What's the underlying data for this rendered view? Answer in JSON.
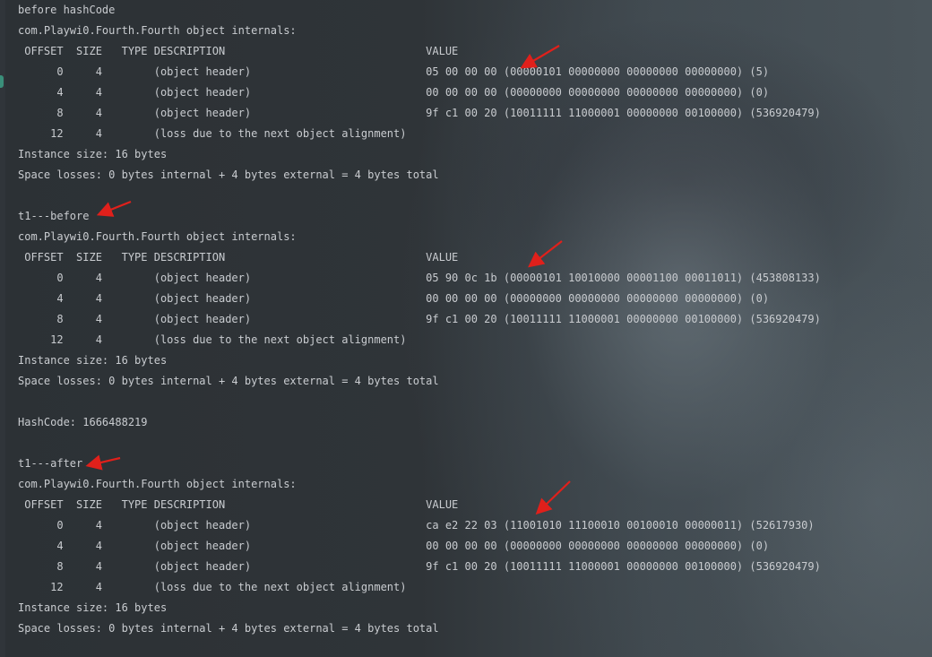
{
  "lines": [
    "before hashCode",
    "com.Playwi0.Fourth.Fourth object internals:",
    " OFFSET  SIZE   TYPE DESCRIPTION                               VALUE",
    "      0     4        (object header)                           05 00 00 00 (00000101 00000000 00000000 00000000) (5)",
    "      4     4        (object header)                           00 00 00 00 (00000000 00000000 00000000 00000000) (0)",
    "      8     4        (object header)                           9f c1 00 20 (10011111 11000001 00000000 00100000) (536920479)",
    "     12     4        (loss due to the next object alignment)",
    "Instance size: 16 bytes",
    "Space losses: 0 bytes internal + 4 bytes external = 4 bytes total",
    "",
    "t1---before",
    "com.Playwi0.Fourth.Fourth object internals:",
    " OFFSET  SIZE   TYPE DESCRIPTION                               VALUE",
    "      0     4        (object header)                           05 90 0c 1b (00000101 10010000 00001100 00011011) (453808133)",
    "      4     4        (object header)                           00 00 00 00 (00000000 00000000 00000000 00000000) (0)",
    "      8     4        (object header)                           9f c1 00 20 (10011111 11000001 00000000 00100000) (536920479)",
    "     12     4        (loss due to the next object alignment)",
    "Instance size: 16 bytes",
    "Space losses: 0 bytes internal + 4 bytes external = 4 bytes total",
    "",
    "HashCode: 1666488219",
    "",
    "t1---after",
    "com.Playwi0.Fourth.Fourth object internals:",
    " OFFSET  SIZE   TYPE DESCRIPTION                               VALUE",
    "      0     4        (object header)                           ca e2 22 03 (11001010 11100010 00100010 00000011) (52617930)",
    "      4     4        (object header)                           00 00 00 00 (00000000 00000000 00000000 00000000) (0)",
    "      8     4        (object header)                           9f c1 00 20 (10011111 11000001 00000000 00100000) (536920479)",
    "     12     4        (loss due to the next object alignment)",
    "Instance size: 16 bytes",
    "Space losses: 0 bytes internal + 4 bytes external = 4 bytes total"
  ],
  "colors": {
    "text": "#c9ccd0",
    "arrow": "#e0201b",
    "gutter_mark": "#3a8f7a"
  },
  "icons": {
    "annotation": "red-arrow-icon"
  }
}
